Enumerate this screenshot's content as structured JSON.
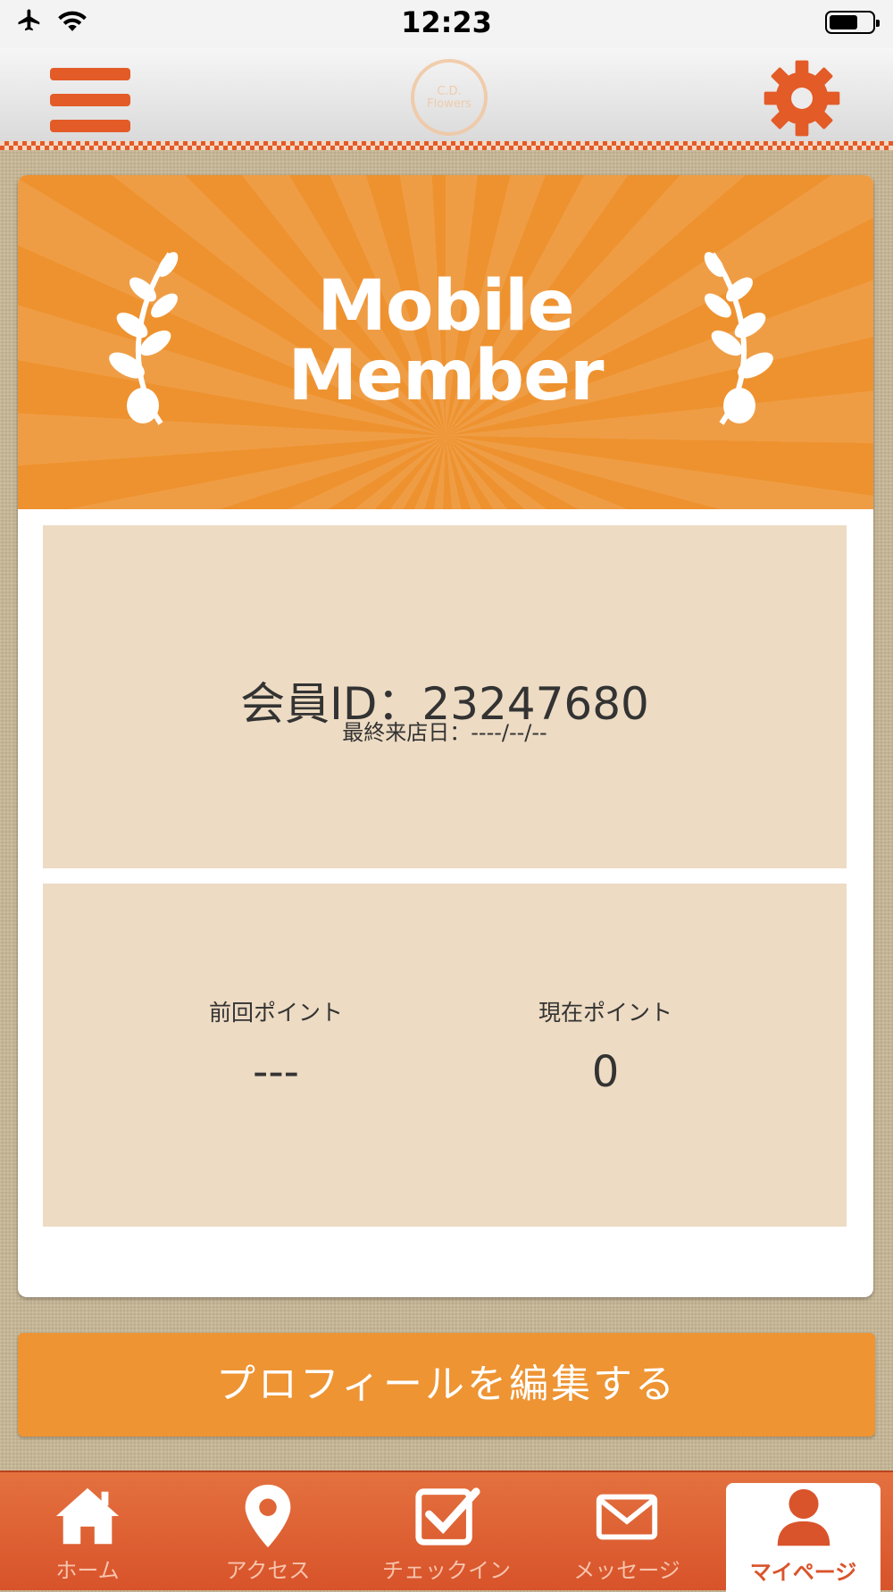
{
  "status_bar": {
    "time": "12:23"
  },
  "header": {
    "logo_text": "C.D. Flowers"
  },
  "banner": {
    "title_line1": "Mobile",
    "title_line2": "Member"
  },
  "member": {
    "id_line": "会員ID：23247680",
    "last_visit_line": "最終来店日：----/--/--"
  },
  "points": {
    "previous_label": "前回ポイント",
    "previous_value": "---",
    "current_label": "現在ポイント",
    "current_value": "0"
  },
  "edit_profile_label": "プロフィールを編集する",
  "tabs": [
    {
      "label": "ホーム",
      "icon": "home-icon"
    },
    {
      "label": "アクセス",
      "icon": "map-pin-icon"
    },
    {
      "label": "チェックイン",
      "icon": "checkbox-icon"
    },
    {
      "label": "メッセージ",
      "icon": "envelope-icon"
    },
    {
      "label": "マイページ",
      "icon": "person-icon",
      "active": true
    }
  ],
  "colors": {
    "accent": "#e35b27",
    "orange": "#ee9433",
    "panel": "#eddbc3"
  }
}
